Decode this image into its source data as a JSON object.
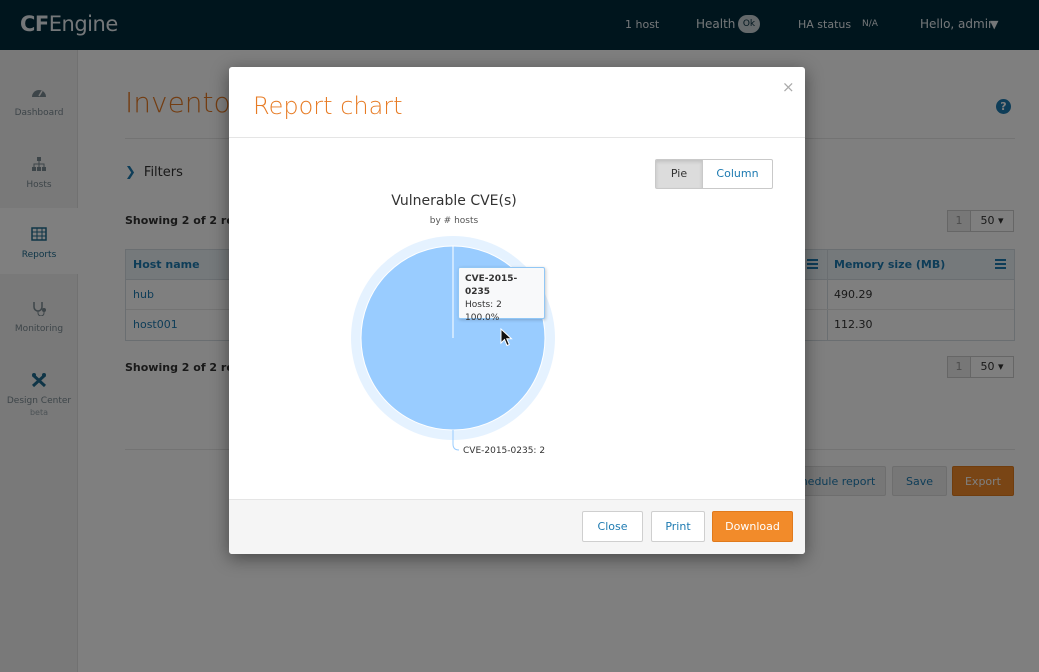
{
  "topbar": {
    "logo_bold": "CF",
    "logo_rest": "Engine",
    "hosts": "1 host",
    "health_label": "Health",
    "health_status": "Ok",
    "ha_label": "HA status",
    "ha_value": "N/A",
    "user": "Hello, admin"
  },
  "sidebar": {
    "items": [
      {
        "label": "Dashboard",
        "icon": "dashboard-icon"
      },
      {
        "label": "Hosts",
        "icon": "hosts-icon"
      },
      {
        "label": "Reports",
        "icon": "reports-icon"
      },
      {
        "label": "Monitoring",
        "icon": "monitoring-icon"
      },
      {
        "label": "Design Center",
        "sublabel": "beta",
        "icon": "design-center-icon"
      }
    ]
  },
  "main": {
    "title": "Invento",
    "filters_label": "Filters",
    "showing_text": "Showing 2 of 2 resu",
    "pager": {
      "page": "1",
      "size": "50"
    },
    "columns": [
      "Host name",
      "Memory size (MB)"
    ],
    "rows": [
      {
        "host": "hub",
        "memory": "490.29"
      },
      {
        "host": "host001",
        "memory": "112.30"
      }
    ],
    "buttons": {
      "schedule": "chedule report",
      "save": "Save",
      "export": "Export"
    }
  },
  "modal": {
    "title": "Report chart",
    "close_symbol": "×",
    "toggle": {
      "pie": "Pie",
      "column": "Column"
    },
    "tooltip": {
      "name": "CVE-2015-0235",
      "hosts": "Hosts: 2",
      "percent": "100.0%"
    },
    "footer": {
      "close": "Close",
      "print": "Print",
      "download": "Download"
    }
  },
  "chart_data": {
    "type": "pie",
    "title": "Vulnerable CVE(s)",
    "subtitle": "by # hosts",
    "categories": [
      "CVE-2015-0235"
    ],
    "values": [
      2
    ],
    "data_labels": [
      "CVE-2015-0235: 2"
    ],
    "legend": "none",
    "colors": [
      "#99ccff"
    ]
  },
  "colors": {
    "accent_orange": "#e77b24",
    "link_blue": "#1d7ab1",
    "topbar": "#012a3a"
  }
}
